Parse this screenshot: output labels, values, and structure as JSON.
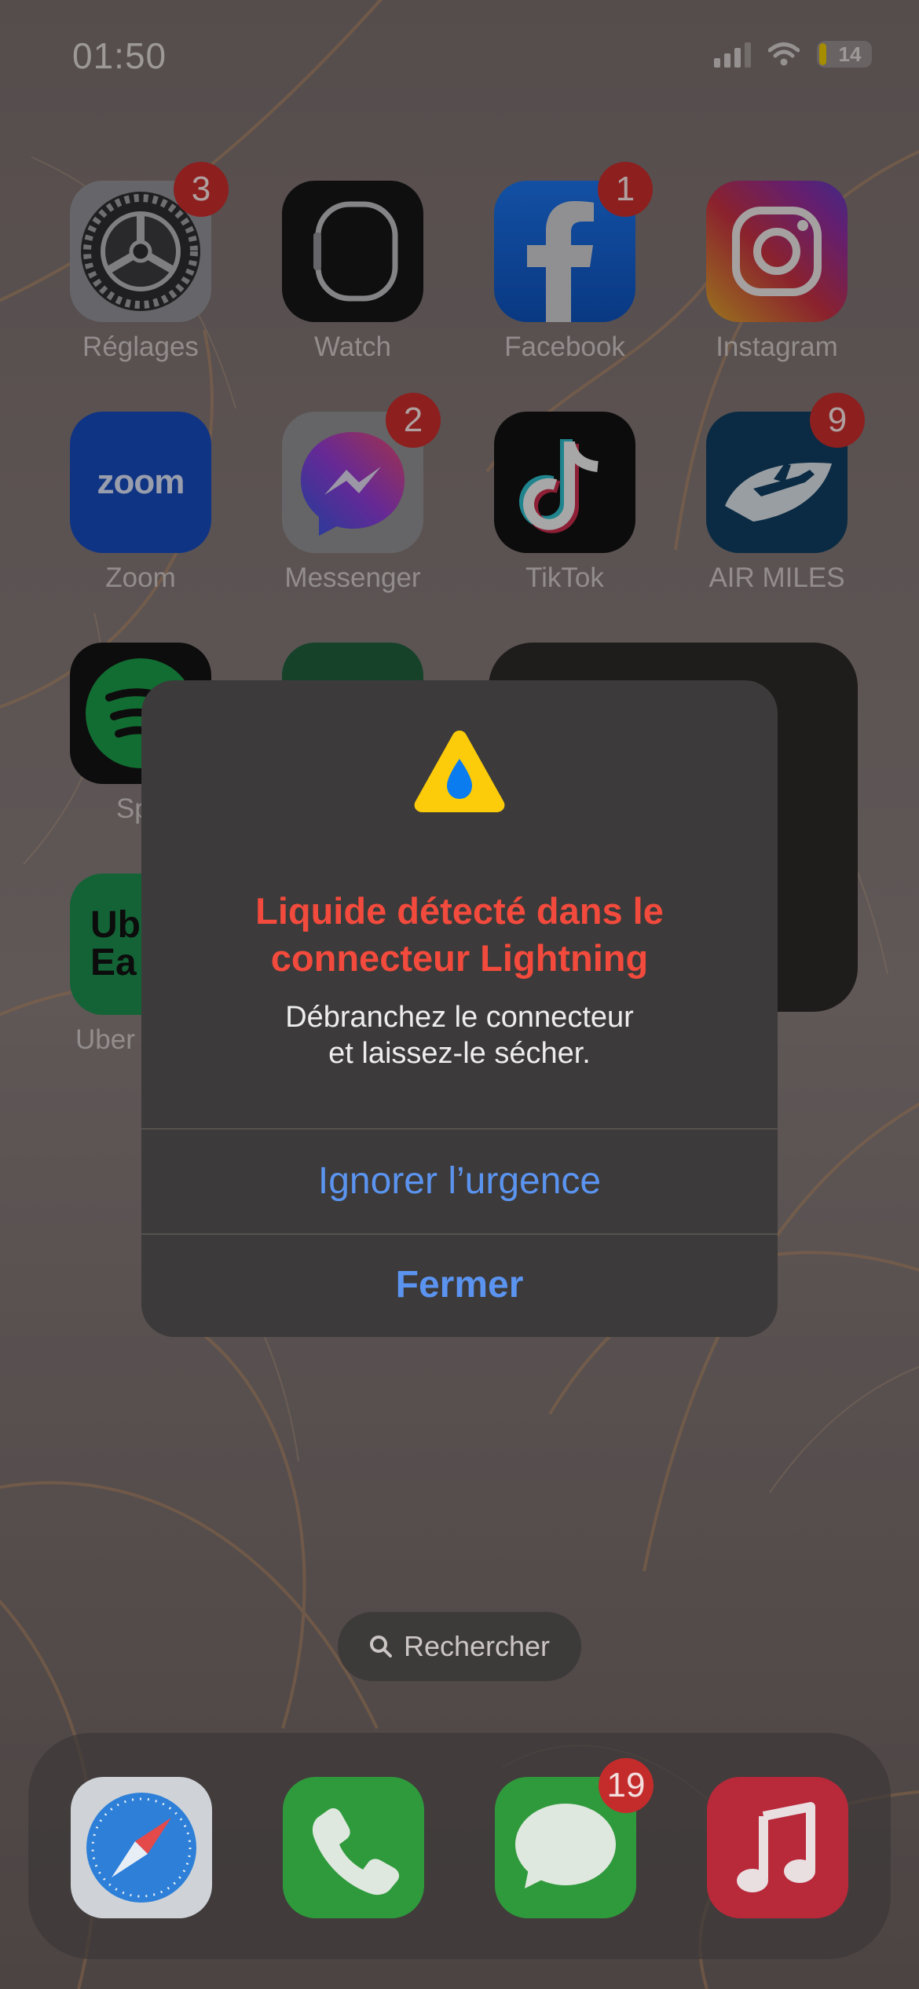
{
  "status_bar": {
    "time": "01:50",
    "battery_percent": "14"
  },
  "apps": [
    {
      "name": "settings",
      "label": "Réglages",
      "badge": "3"
    },
    {
      "name": "watch",
      "label": "Watch",
      "badge": null
    },
    {
      "name": "facebook",
      "label": "Facebook",
      "badge": "1"
    },
    {
      "name": "instagram",
      "label": "Instagram",
      "badge": null
    },
    {
      "name": "zoom",
      "label": "Zoom",
      "badge": null,
      "icon_text": "zoom"
    },
    {
      "name": "messenger",
      "label": "Messenger",
      "badge": "2"
    },
    {
      "name": "tiktok",
      "label": "TikTok",
      "badge": null
    },
    {
      "name": "air-miles",
      "label": "AIR MILES",
      "badge": "9"
    },
    {
      "name": "spotify",
      "label": "Spo",
      "badge": null
    },
    {
      "name": "uber-eats",
      "label": "Uber",
      "badge": null,
      "icon_text": "Ub Ea"
    }
  ],
  "alert": {
    "icon": "water-drop-warning-icon",
    "title_line1": "Liquide détecté dans le",
    "title_line2": "connecteur Lightning",
    "message_line1": "Débranchez le connecteur",
    "message_line2": "et laissez-le sécher.",
    "button_emergency_override": "Ignorer l’urgence",
    "button_close": "Fermer",
    "title_color": "#f24a3c",
    "button_color": "#5b94f0"
  },
  "search": {
    "label": "Rechercher"
  },
  "dock": [
    {
      "name": "safari",
      "badge": null
    },
    {
      "name": "phone",
      "badge": null
    },
    {
      "name": "messages",
      "badge": "19"
    },
    {
      "name": "music",
      "badge": null
    }
  ]
}
